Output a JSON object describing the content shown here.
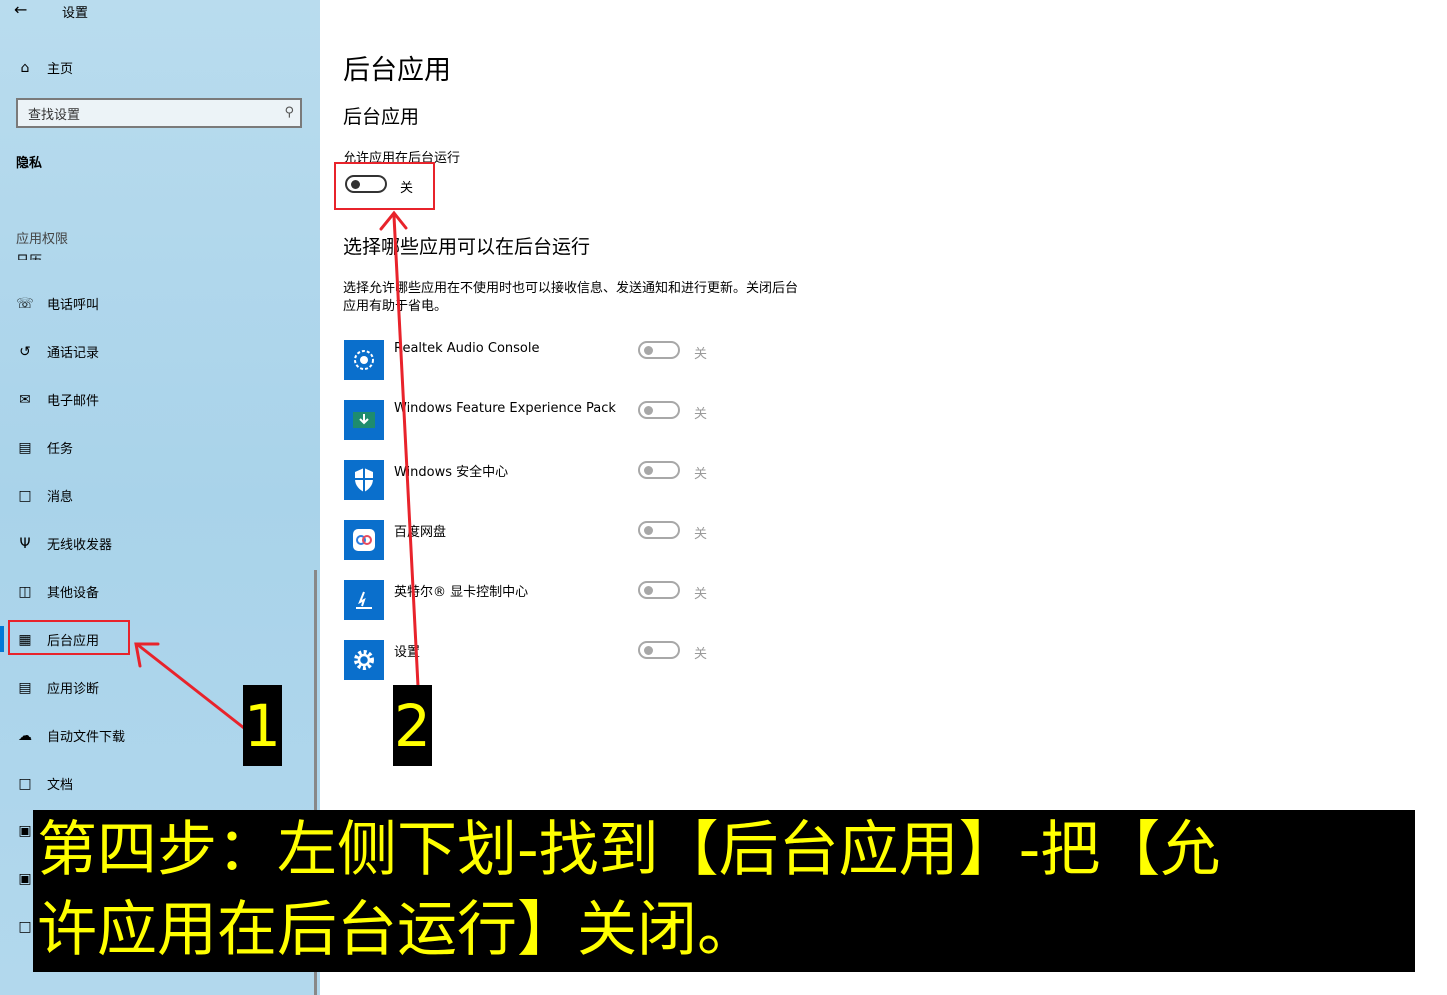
{
  "window": {
    "back_icon": "back-arrow-icon",
    "title": "设置"
  },
  "sidebar": {
    "home": "主页",
    "search_placeholder": "查找设置",
    "section": "隐私",
    "group": "应用权限",
    "partial_item": "日历",
    "items": [
      {
        "label": "电话呼叫",
        "icon": "phone-icon"
      },
      {
        "label": "通话记录",
        "icon": "history-icon"
      },
      {
        "label": "电子邮件",
        "icon": "mail-icon"
      },
      {
        "label": "任务",
        "icon": "clipboard-icon"
      },
      {
        "label": "消息",
        "icon": "chat-icon"
      },
      {
        "label": "无线收发器",
        "icon": "antenna-icon"
      },
      {
        "label": "其他设备",
        "icon": "devices-icon"
      },
      {
        "label": "后台应用",
        "icon": "background-apps-icon",
        "selected": true
      },
      {
        "label": "应用诊断",
        "icon": "diagnostics-icon"
      },
      {
        "label": "自动文件下载",
        "icon": "cloud-icon"
      },
      {
        "label": "文档",
        "icon": "document-icon"
      }
    ]
  },
  "main": {
    "title": "后台应用",
    "subtitle": "后台应用",
    "allow_label": "允许应用在后台运行",
    "allow_state": "关",
    "choose_heading": "选择哪些应用可以在后台运行",
    "description": "选择允许哪些应用在不使用时也可以接收信息、发送通知和进行更新。关闭后台应用有助于省电。",
    "apps": [
      {
        "name": "Realtek Audio Console",
        "state": "关",
        "icon": "realtek-audio-icon"
      },
      {
        "name": "Windows Feature Experience Pack",
        "state": "关",
        "icon": "feature-pack-icon"
      },
      {
        "name": "Windows 安全中心",
        "state": "关",
        "icon": "shield-icon"
      },
      {
        "name": "百度网盘",
        "state": "关",
        "icon": "baidu-netdisk-icon"
      },
      {
        "name": "英特尔® 显卡控制中心",
        "state": "关",
        "icon": "intel-graphics-icon"
      },
      {
        "name": "设置",
        "state": "关",
        "icon": "gear-icon"
      }
    ]
  },
  "annotations": {
    "step1": "1",
    "step2": "2",
    "caption_line1": "第四步：左侧下划-找到【后台应用】-把【允",
    "caption_line2": "许应用在后台运行】关闭。",
    "highlight_color": "#e8232b",
    "caption_text_color": "#ffff00"
  }
}
